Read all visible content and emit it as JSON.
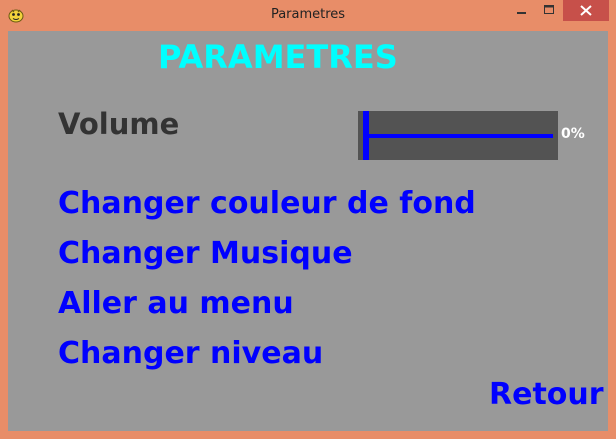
{
  "window": {
    "title": "Parametres",
    "icon": "pygame-snake-icon",
    "controls": [
      "minimize-icon",
      "maximize-icon",
      "close-icon"
    ],
    "frame_color": "#e88d68",
    "close_color": "#c7504a"
  },
  "screen": {
    "background": "#999999",
    "heading": "PARAMETRES",
    "heading_color": "#00ffff",
    "volume": {
      "label": "Volume",
      "value_text": "0%",
      "level": 0
    },
    "options": [
      {
        "label": "Changer couleur de fond"
      },
      {
        "label": "Changer Musique"
      },
      {
        "label": "Aller au menu"
      },
      {
        "label": "Changer niveau"
      }
    ],
    "option_color": "#0000ff",
    "back_label": "Retour"
  }
}
